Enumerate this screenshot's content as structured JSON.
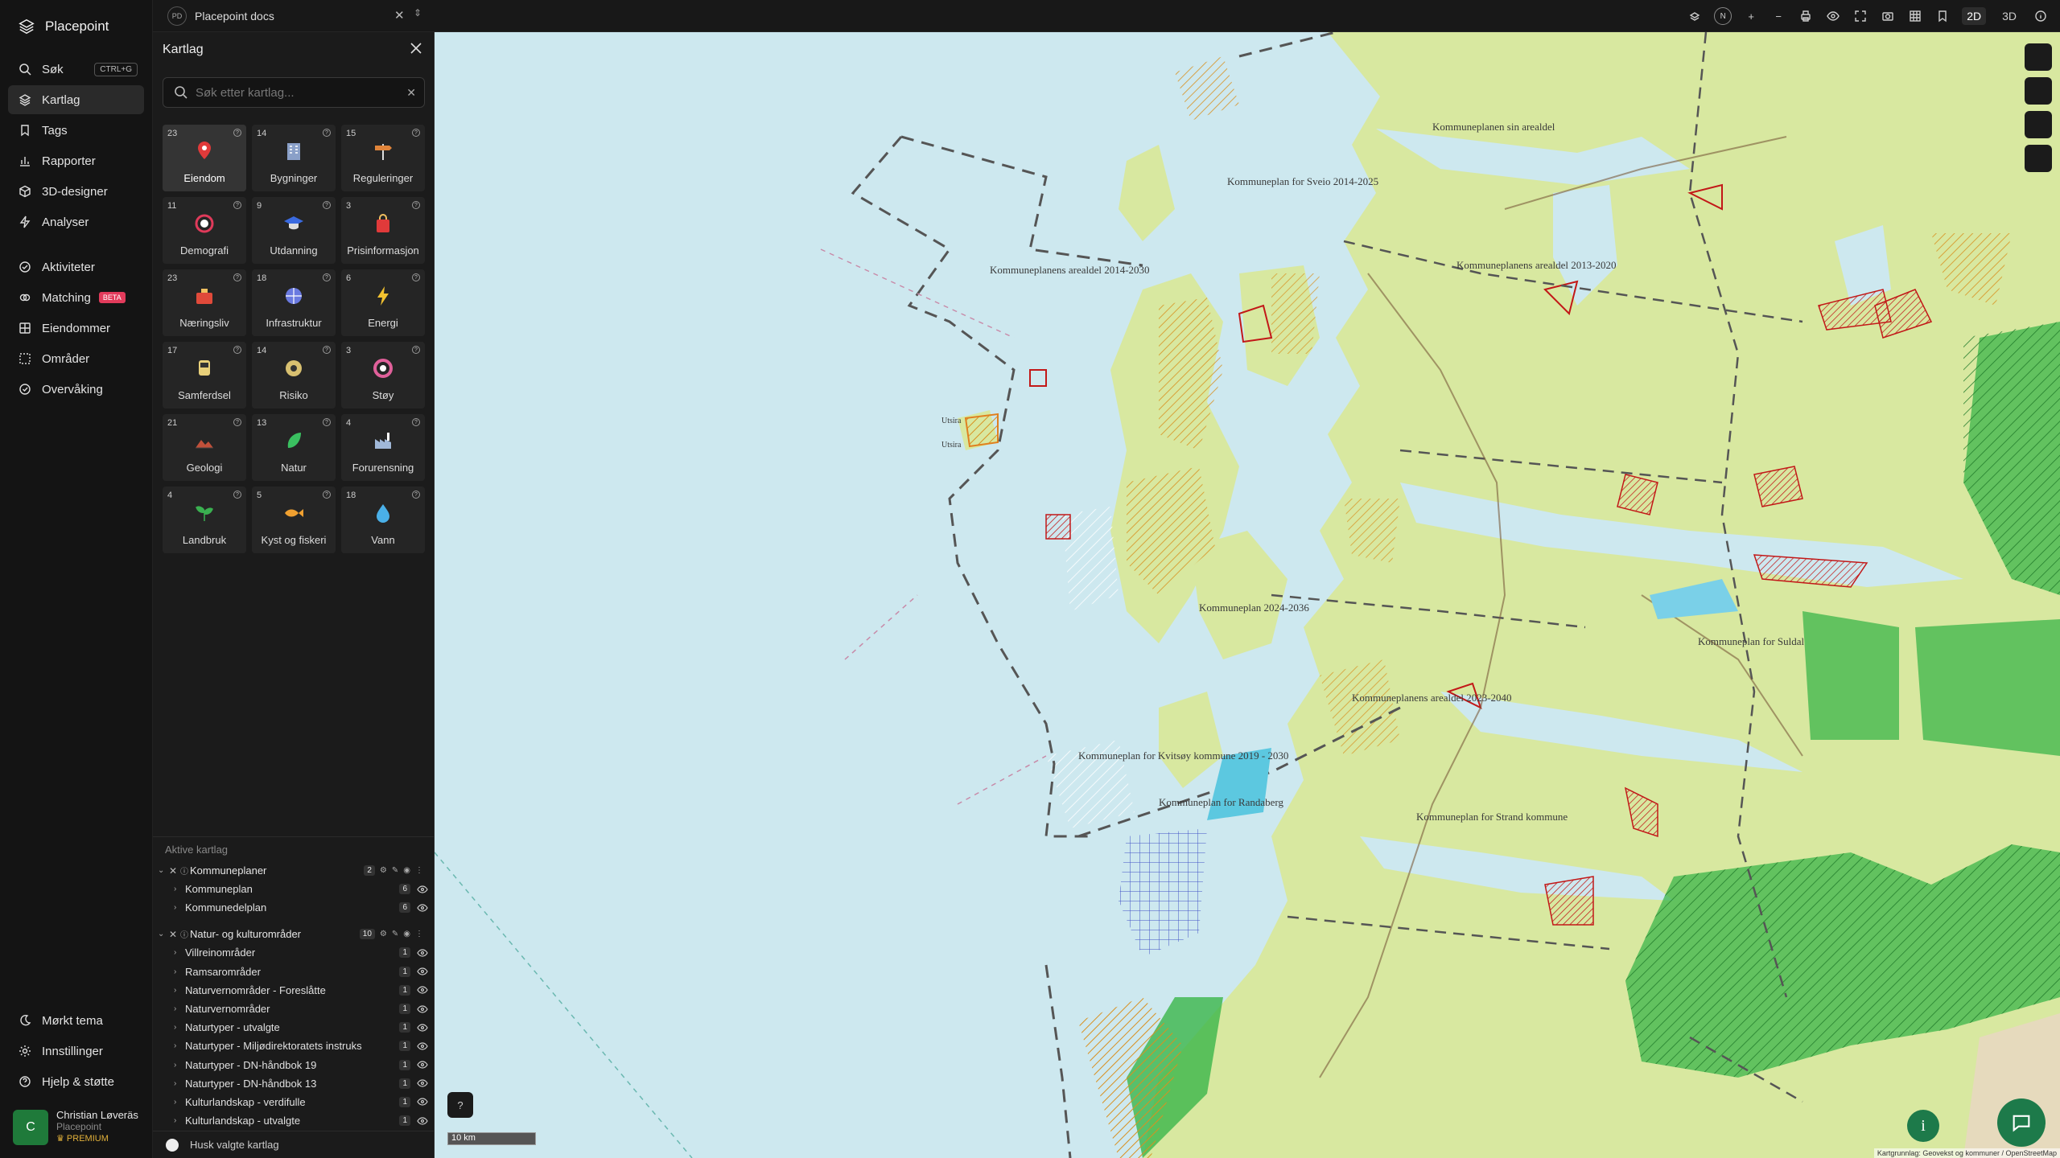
{
  "app": {
    "name": "Placepoint"
  },
  "nav": {
    "items": [
      {
        "label": "Søk",
        "shortcut": "CTRL+G"
      },
      {
        "label": "Kartlag"
      },
      {
        "label": "Tags"
      },
      {
        "label": "Rapporter"
      },
      {
        "label": "3D-designer"
      },
      {
        "label": "Analyser"
      },
      {
        "label": "Aktiviteter"
      },
      {
        "label": "Matching",
        "badge": "BETA"
      },
      {
        "label": "Eiendommer"
      },
      {
        "label": "Områder"
      },
      {
        "label": "Overvåking"
      }
    ],
    "bottom": [
      {
        "label": "Mørkt tema"
      },
      {
        "label": "Innstillinger"
      },
      {
        "label": "Hjelp & støtte"
      }
    ],
    "user": {
      "initial": "C",
      "name": "Christian Løveräs",
      "org": "Placepoint",
      "plan": "PREMIUM"
    }
  },
  "topbar": {
    "workspace_badge": "PD",
    "workspace_name": "Placepoint docs",
    "north": "N",
    "mode_2d": "2D",
    "mode_3d": "3D"
  },
  "panel": {
    "title": "Kartlag",
    "search_placeholder": "Søk etter kartlag...",
    "categories": [
      {
        "count": "23",
        "name": "Eiendom",
        "icon": "pin-icon",
        "color": "#e03a3a"
      },
      {
        "count": "14",
        "name": "Bygninger",
        "icon": "building-icon",
        "color": "#8aa0c8"
      },
      {
        "count": "15",
        "name": "Reguleringer",
        "icon": "signpost-icon",
        "color": "#e0843a"
      },
      {
        "count": "11",
        "name": "Demografi",
        "icon": "chart-ring-icon",
        "color": "#e03a5a"
      },
      {
        "count": "9",
        "name": "Utdanning",
        "icon": "graduation-cap-icon",
        "color": "#3a6ae0"
      },
      {
        "count": "3",
        "name": "Prisinformasjon",
        "icon": "shopping-bag-icon",
        "color": "#e03a3a"
      },
      {
        "count": "23",
        "name": "Næringsliv",
        "icon": "briefcase-icon",
        "color": "#e04a3a"
      },
      {
        "count": "18",
        "name": "Infrastruktur",
        "icon": "globe-icon",
        "color": "#6a7ae0"
      },
      {
        "count": "6",
        "name": "Energi",
        "icon": "lightning-icon",
        "color": "#f2c230"
      },
      {
        "count": "17",
        "name": "Samferdsel",
        "icon": "bus-icon",
        "color": "#e8d07a"
      },
      {
        "count": "14",
        "name": "Risiko",
        "icon": "hazard-icon",
        "color": "#d8c070"
      },
      {
        "count": "3",
        "name": "Støy",
        "icon": "noise-ring-icon",
        "color": "#e0609a"
      },
      {
        "count": "21",
        "name": "Geologi",
        "icon": "terrain-icon",
        "color": "#c0503a"
      },
      {
        "count": "13",
        "name": "Natur",
        "icon": "leaf-icon",
        "color": "#3ac060"
      },
      {
        "count": "4",
        "name": "Forurensning",
        "icon": "factory-icon",
        "color": "#a0b8d8"
      },
      {
        "count": "4",
        "name": "Landbruk",
        "icon": "sprout-icon",
        "color": "#3ab050"
      },
      {
        "count": "5",
        "name": "Kyst og fiskeri",
        "icon": "fish-icon",
        "color": "#f0a030"
      },
      {
        "count": "18",
        "name": "Vann",
        "icon": "water-drop-icon",
        "color": "#4ab0e8"
      }
    ],
    "active_title": "Aktive kartlag",
    "groups": [
      {
        "name": "Kommuneplaner",
        "count": "2",
        "layers": [
          {
            "name": "Kommuneplan",
            "count": "6"
          },
          {
            "name": "Kommunedelplan",
            "count": "6"
          }
        ]
      },
      {
        "name": "Natur- og kulturområder",
        "count": "10",
        "layers": [
          {
            "name": "Villreinområder",
            "count": "1"
          },
          {
            "name": "Ramsarområder",
            "count": "1"
          },
          {
            "name": "Naturvernområder - Foreslåtte",
            "count": "1"
          },
          {
            "name": "Naturvernområder",
            "count": "1"
          },
          {
            "name": "Naturtyper - utvalgte",
            "count": "1"
          },
          {
            "name": "Naturtyper - Miljødirektoratets instruks",
            "count": "1"
          },
          {
            "name": "Naturtyper - DN-håndbok 19",
            "count": "1"
          },
          {
            "name": "Naturtyper - DN-håndbok 13",
            "count": "1"
          },
          {
            "name": "Kulturlandskap - verdifulle",
            "count": "1"
          },
          {
            "name": "Kulturlandskap - utvalgte",
            "count": "1"
          }
        ]
      }
    ],
    "remember": "Husk valgte kartlag"
  },
  "map": {
    "labels": [
      "Kommuneplanens arealdel 2014-2030",
      "Kommuneplan for Sveio 2014-2025",
      "Kommuneplanen sin arealdel",
      "Kommuneplanens arealdel 2013-2020",
      "Kommuneplan for Kvitsøy kommune 2019 - 2030",
      "Kommuneplan for Randaberg",
      "Kommuneplan for Strand kommune",
      "Kommuneplanens arealdel 2023-2040",
      "Kommuneplan 2024-2036",
      "Kommuneplan for Suldal",
      "Utsira",
      "Utsira"
    ],
    "scale": "10 km",
    "attribution": "Kartgrunnlag: Geovekst og kommuner / OpenStreetMap",
    "colors": {
      "sea": "#cde8ef",
      "land": "#d8e8a0",
      "protected": "#3bb54a",
      "plan_hatch": "#d4a020",
      "boundary": "#555555",
      "red_zone": "#d42020"
    }
  }
}
